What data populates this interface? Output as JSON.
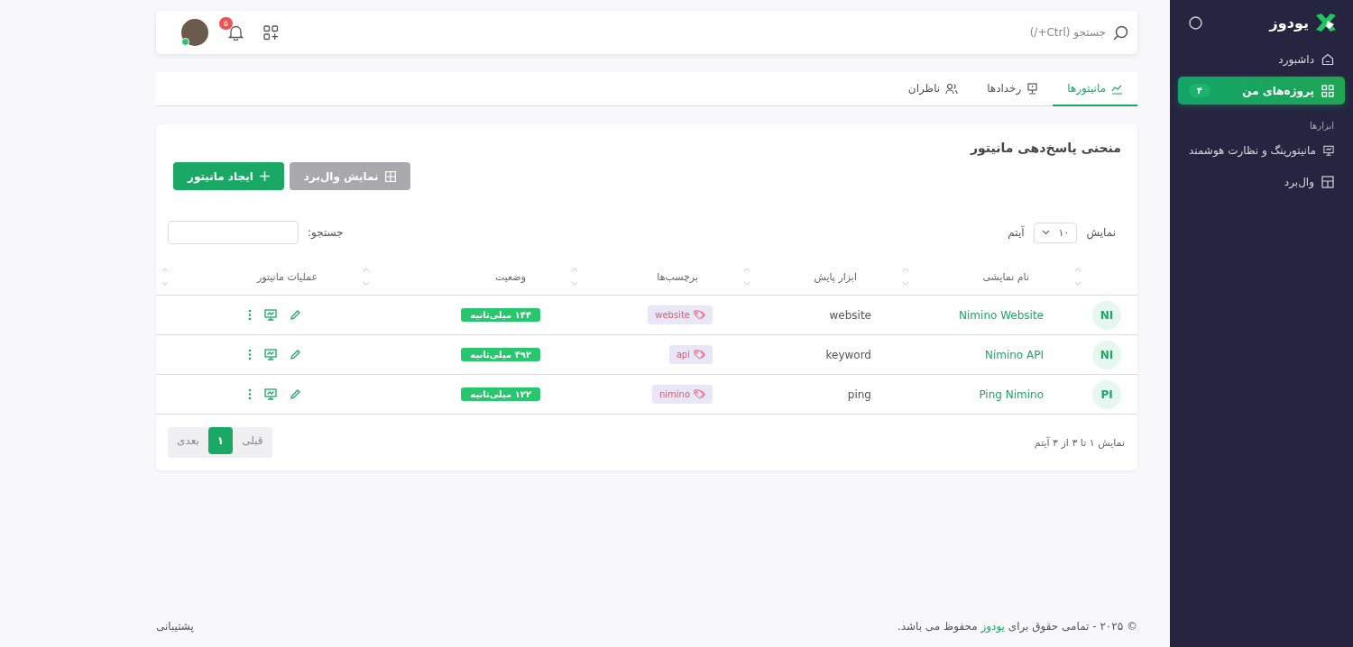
{
  "sidebar": {
    "logo": "یودوز",
    "items": [
      {
        "label": "داشبورد",
        "selected": false
      },
      {
        "label": "پروژه‌های من",
        "selected": true,
        "badge": "۴"
      }
    ],
    "section_label": "ابزارها",
    "tools": [
      {
        "label": "مانیتورینگ و نظارت هوشمند",
        "selected": false
      },
      {
        "label": "وال‌برد",
        "selected": false
      }
    ]
  },
  "topbar": {
    "search_placeholder": "جستجو (Ctrl+/)",
    "notification_count": "۵",
    "user_online": true
  },
  "tabs": [
    {
      "label": "مانیتورها",
      "selected": true
    },
    {
      "label": "رخدادها",
      "selected": false
    },
    {
      "label": "ناظران",
      "selected": false
    }
  ],
  "card": {
    "title": "منحنی پاسخ‌دهی مانیتور",
    "buttons": [
      {
        "label": "نمایش وال‌برد",
        "kind": "secondary"
      },
      {
        "label": "ایجاد مانیتور",
        "kind": "primary"
      }
    ],
    "length": {
      "before": "نمایش",
      "value": "۱۰",
      "after": "آیتم"
    },
    "search_label": "جستجو:",
    "table": {
      "columns": [
        "",
        "نام نمایشی",
        "ابزار پایش",
        "برچسب‌ها",
        "وضعیت",
        "عملیات مانیتور"
      ],
      "rows": [
        {
          "initials": "NI",
          "name": "Nimino Website",
          "tool": "website",
          "tag": "website",
          "status": "۱۴۴ میلی‌ثانیه"
        },
        {
          "initials": "NI",
          "name": "Nimino API",
          "tool": "keyword",
          "tag": "api",
          "status": "۴۹۲ میلی‌ثانیه"
        },
        {
          "initials": "PI",
          "name": "Ping Nimino",
          "tool": "ping",
          "tag": "nimino",
          "status": "۱۲۲ میلی‌ثانیه"
        }
      ]
    },
    "info": "نمایش ۱ تا ۳ از ۳ آیتم",
    "pager": [
      {
        "label": "قبلی",
        "kind": "nav",
        "selected": false
      },
      {
        "label": "۱",
        "kind": "page",
        "selected": true
      },
      {
        "label": "بعدی",
        "kind": "nav",
        "selected": false
      }
    ]
  },
  "footer": {
    "before": "© ۲۰۲۵ - تمامی حقوق برای",
    "brand": "یودوز",
    "after": "محفوظ می باشد.",
    "support": "پشتیبانی"
  }
}
